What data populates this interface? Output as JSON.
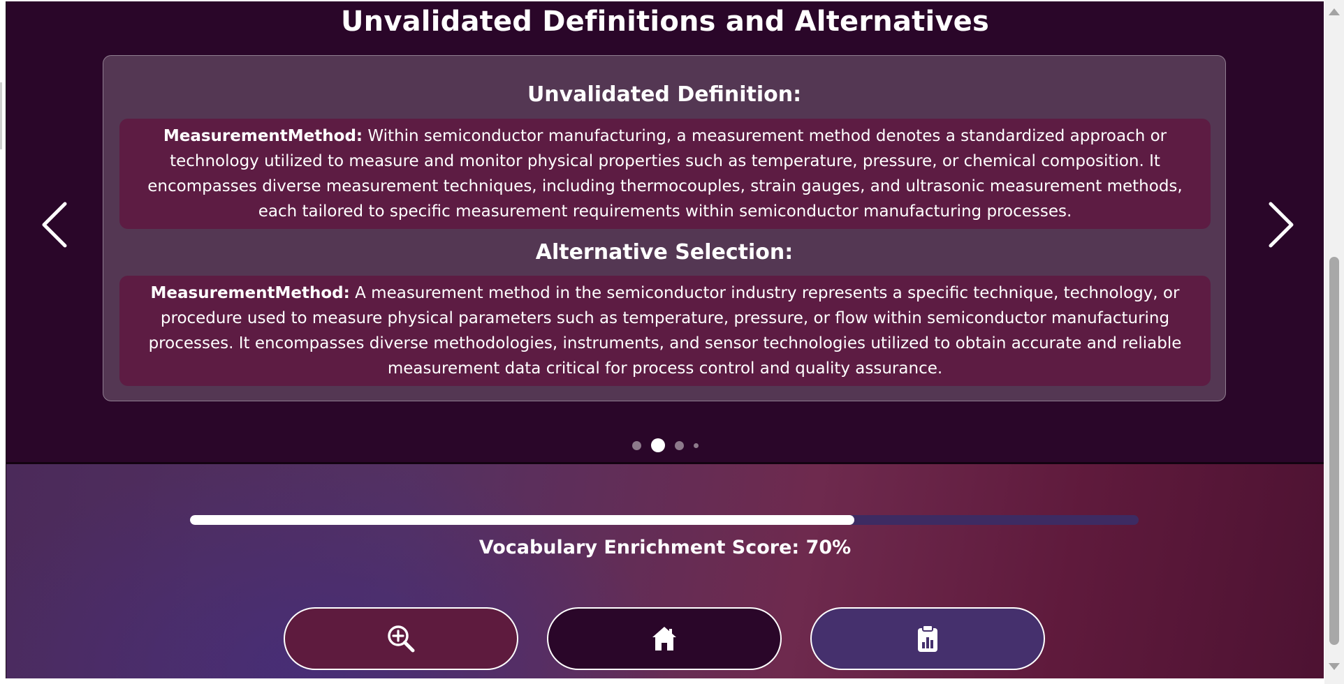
{
  "page": {
    "title": "Unvalidated Definitions and Alternatives"
  },
  "card": {
    "definition_heading": "Unvalidated Definition:",
    "definition_term": "MeasurementMethod:",
    "definition_text": " Within semiconductor manufacturing, a measurement method denotes a standardized approach or technology utilized to measure and monitor physical properties such as temperature, pressure, or chemical composition. It encompasses diverse measurement techniques, including thermocouples, strain gauges, and ultrasonic measurement methods, each tailored to specific measurement requirements within semiconductor manufacturing processes.",
    "alternative_heading": "Alternative Selection:",
    "alternative_term": "MeasurementMethod:",
    "alternative_text": " A measurement method in the semiconductor industry represents a specific technique, technology, or procedure used to measure physical parameters such as temperature, pressure, or flow within semiconductor manufacturing processes. It encompasses diverse methodologies, instruments, and sensor technologies utilized to obtain accurate and reliable measurement data critical for process control and quality assurance."
  },
  "carousel": {
    "prev_icon": "chevron-left-icon",
    "next_icon": "chevron-right-icon",
    "slide_count": 4,
    "active_index": 1
  },
  "score": {
    "label": "Vocabulary Enrichment Score: 70%",
    "value_percent": 70
  },
  "buttons": [
    {
      "icon": "zoom-in-icon",
      "color": "#5e1b3e"
    },
    {
      "icon": "home-icon",
      "color": "#2a0629"
    },
    {
      "icon": "clipboard-chart-icon",
      "color": "#45306d"
    }
  ],
  "colors": {
    "top_background": "#2a0629",
    "text_box": "#5d1c43",
    "progress_track": "#3d2b62",
    "progress_fill": "#ffffff"
  }
}
